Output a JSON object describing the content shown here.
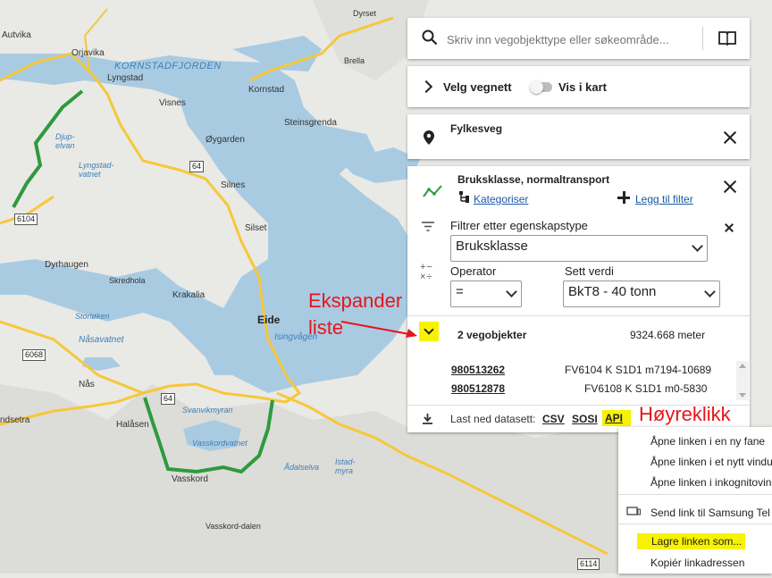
{
  "map": {
    "places": [
      "Autvika",
      "Orjavika",
      "KORNSTADFJORDEN",
      "Lyngstad",
      "Visnes",
      "Kornstad",
      "Steinsgrenda",
      "Øygarden",
      "Silnes",
      "Silset",
      "Dyrhaugen",
      "Skredhola",
      "Krakalia",
      "Eide",
      "Nås",
      "Halåsen",
      "Vasskord",
      "Vasskord-dalen",
      "Brella",
      "Dyrset",
      "ndsetra"
    ],
    "water": [
      "Djup-elvan",
      "Lyngstad-vatnet",
      "Storløken",
      "Nåsavatnet",
      "Isingvågen",
      "Svanvikmyran",
      "Vasskordvatnet",
      "Ådalselva",
      "Istad-myra"
    ],
    "roads": [
      "64",
      "64",
      "6104",
      "6068",
      "6114"
    ]
  },
  "search": {
    "placeholder": "Skriv inn vegobjekttype eller søkeområde...",
    "icon": "search-icon",
    "book_icon": "book-icon"
  },
  "road_network": {
    "label": "Velg vegnett",
    "toggle_label": "Vis i kart"
  },
  "area_filter": {
    "label": "Fylkesveg"
  },
  "object_panel": {
    "title": "Bruksklasse, normaltransport",
    "categorize": "Kategoriser",
    "add_filter": "Legg til filter",
    "filter_label": "Filtrer etter egenskapstype",
    "filter_value": "Bruksklasse",
    "operator_label": "Operator",
    "operator_value": "=",
    "value_label": "Sett verdi",
    "value_value": "BkT8 - 40 tonn",
    "count_text": "2 vegobjekter",
    "length_text": "9324.668 meter",
    "objects": [
      {
        "id": "980513262",
        "ref": "FV6104 K S1D1 m7194-10689"
      },
      {
        "id": "980512878",
        "ref": "FV6108 K S1D1 m0-5830"
      }
    ],
    "download_label": "Last ned datasett:",
    "formats": [
      "CSV",
      "SOSI",
      "API"
    ]
  },
  "context_menu": {
    "items": [
      "Åpne linken i en ny fane",
      "Åpne linken i et nytt vindu",
      "Åpne linken i inkognitovindu",
      "Send link til Samsung Tel",
      "Lagre linken som...",
      "Kopiér linkadressen"
    ]
  },
  "annotations": {
    "expand_line1": "Ekspander",
    "expand_line2": "liste",
    "right_click": "Høyreklikk"
  },
  "colors": {
    "water": "#a9cbe2",
    "land": "#ebebea",
    "road": "#f6c838",
    "highlight_route": "#2e9a3e",
    "annotation": "#e8141b",
    "highlight_marker": "#f7f300"
  }
}
